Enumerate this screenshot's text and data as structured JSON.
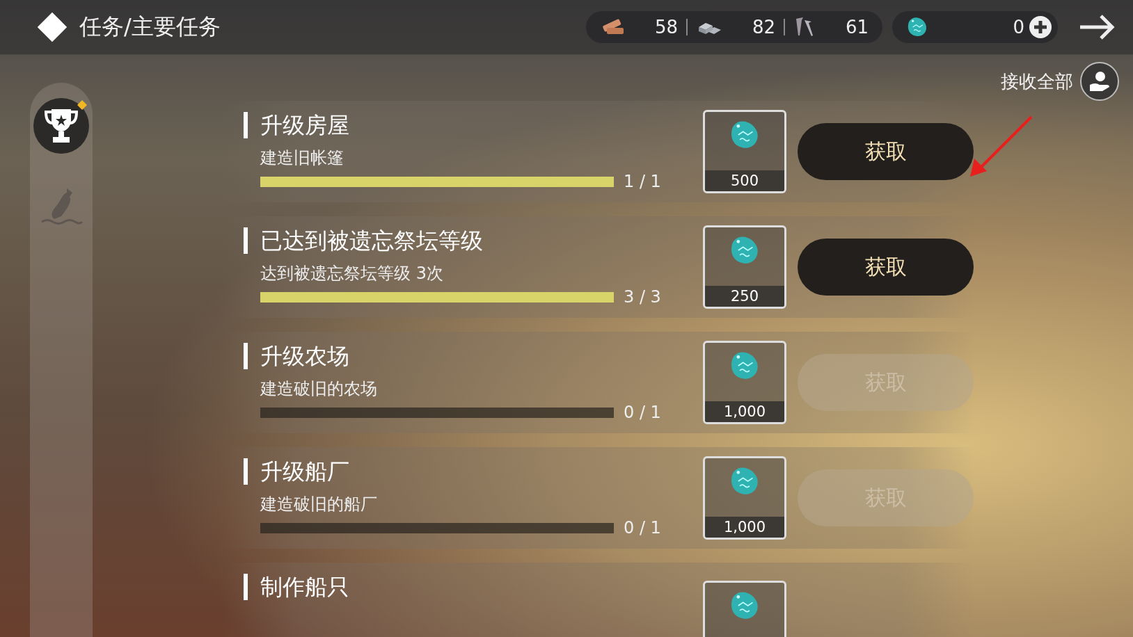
{
  "header": {
    "title": "任务/主要任务"
  },
  "resources": [
    {
      "kind": "wood",
      "value": "58"
    },
    {
      "kind": "stone",
      "value": "82"
    },
    {
      "kind": "nail",
      "value": "61"
    }
  ],
  "currency": {
    "value": "0"
  },
  "claim_all": {
    "label": "接收全部"
  },
  "sidebar": {
    "items": [
      {
        "kind": "trophy",
        "selected": true
      },
      {
        "kind": "bottle",
        "selected": false
      }
    ]
  },
  "tasks": [
    {
      "title": "升级房屋",
      "subtitle": "建造旧帐篷",
      "level": 1,
      "count": "1 / 1",
      "reward": "500",
      "button": "获取",
      "disabled": false
    },
    {
      "title": "已达到被遗忘祭坛等级",
      "subtitle": "达到被遗忘祭坛等级 3次",
      "level": 1,
      "count": "3 / 3",
      "reward": "250",
      "button": "获取",
      "disabled": false
    },
    {
      "title": "升级农场",
      "subtitle": "建造破旧的农场",
      "level": 0,
      "count": "0 / 1",
      "reward": "1,000",
      "button": "获取",
      "disabled": true
    },
    {
      "title": "升级船厂",
      "subtitle": "建造破旧的船厂",
      "level": 0,
      "count": "0 / 1",
      "reward": "1,000",
      "button": "获取",
      "disabled": true
    },
    {
      "title": "制作船只"
    }
  ]
}
